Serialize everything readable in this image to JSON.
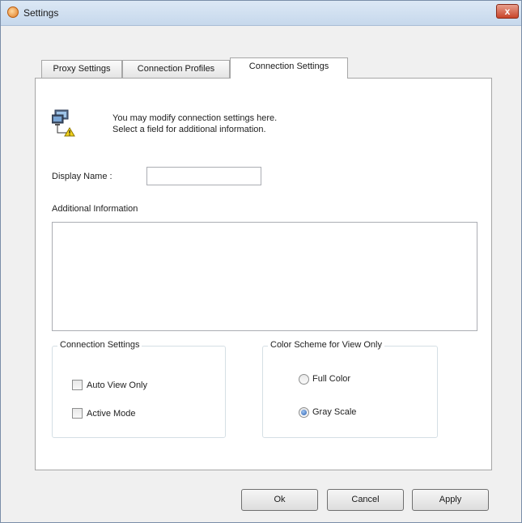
{
  "window": {
    "title": "Settings",
    "close_label": "x"
  },
  "tabs": [
    {
      "label": "Proxy Settings"
    },
    {
      "label": "Connection Profiles"
    },
    {
      "label": "Connection Settings"
    }
  ],
  "intro": {
    "line1": "You may modify connection settings here.",
    "line2": "Select a field for additional information."
  },
  "display_name": {
    "label": "Display Name :",
    "value": "",
    "placeholder": ""
  },
  "additional_info": {
    "label": "Additional Information",
    "value": ""
  },
  "connection_settings": {
    "legend": "Connection Settings",
    "options": [
      {
        "label": "Auto View Only",
        "checked": false
      },
      {
        "label": "Active Mode",
        "checked": false
      }
    ]
  },
  "color_scheme": {
    "legend": "Color Scheme for View Only",
    "options": [
      {
        "label": "Full Color",
        "selected": false
      },
      {
        "label": "Gray Scale",
        "selected": true
      }
    ]
  },
  "buttons": {
    "ok": "Ok",
    "cancel": "Cancel",
    "apply": "Apply"
  }
}
